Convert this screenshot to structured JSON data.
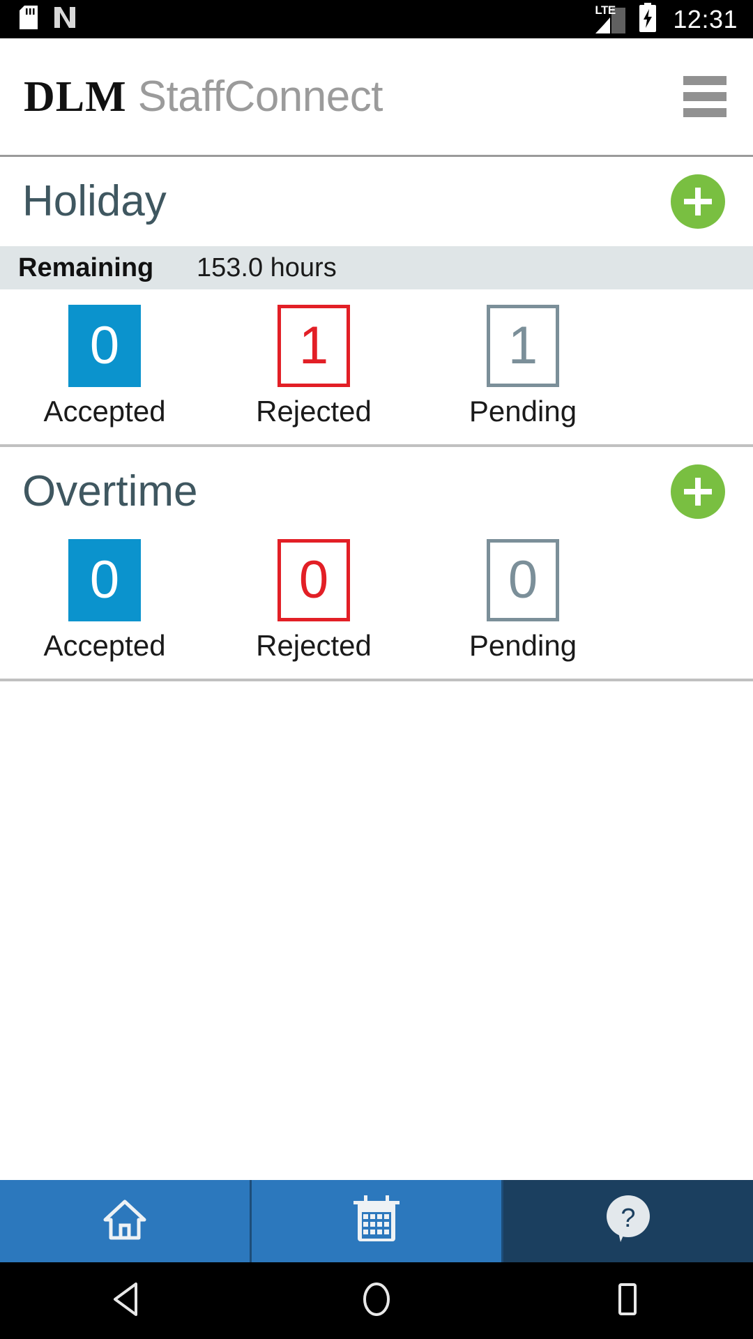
{
  "status_bar": {
    "icons": [
      "sd-card-icon",
      "nfc-icon"
    ],
    "network_label": "LTE",
    "signal_icon": "signal-bars-icon",
    "battery_icon": "battery-charging-icon",
    "clock": "12:31"
  },
  "header": {
    "brand_primary": "DLM",
    "brand_secondary": "StaffConnect",
    "menu_icon": "hamburger-menu-icon"
  },
  "sections": [
    {
      "id": "holiday",
      "title": "Holiday",
      "add_label": "+",
      "remaining": {
        "label": "Remaining",
        "value": "153.0 hours"
      },
      "stats": [
        {
          "value": "0",
          "label": "Accepted",
          "style": "accepted"
        },
        {
          "value": "1",
          "label": "Rejected",
          "style": "rejected"
        },
        {
          "value": "1",
          "label": "Pending",
          "style": "pending"
        }
      ]
    },
    {
      "id": "overtime",
      "title": "Overtime",
      "add_label": "+",
      "stats": [
        {
          "value": "0",
          "label": "Accepted",
          "style": "accepted"
        },
        {
          "value": "0",
          "label": "Rejected",
          "style": "rejected"
        },
        {
          "value": "0",
          "label": "Pending",
          "style": "pending"
        }
      ]
    }
  ],
  "bottom_nav": [
    {
      "icon": "home-icon",
      "name": "nav-home"
    },
    {
      "icon": "calendar-icon",
      "name": "nav-calendar"
    },
    {
      "icon": "help-question-icon",
      "name": "nav-help"
    }
  ],
  "android_nav": [
    {
      "icon": "back-triangle-icon"
    },
    {
      "icon": "home-circle-icon"
    },
    {
      "icon": "recents-square-icon"
    }
  ],
  "colors": {
    "accent_green": "#79bf41",
    "accepted_blue": "#0b93cd",
    "rejected_red": "#e21f26",
    "pending_gray": "#7b8f99",
    "title_slate": "#3f5760",
    "nav_blue": "#2c78bd",
    "nav_dark_blue": "#1b3f5f",
    "remaining_bg": "#dfe5e7"
  }
}
